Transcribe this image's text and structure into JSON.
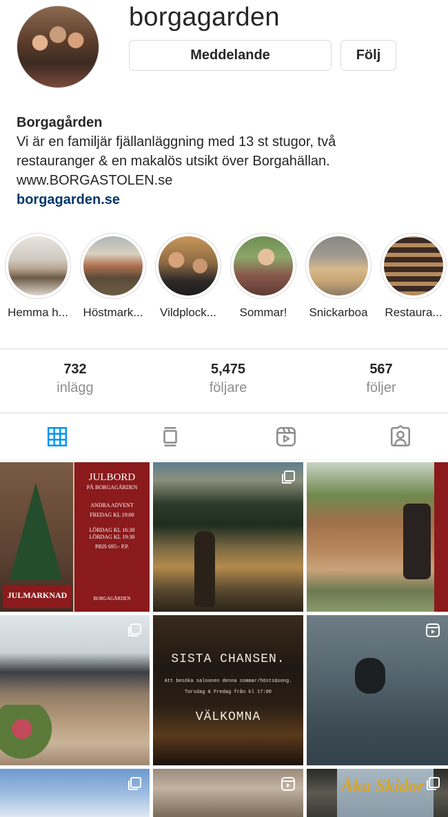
{
  "profile": {
    "username": "borgagarden",
    "message_label": "Meddelande",
    "follow_label": "Följ",
    "name": "Borgagården",
    "bio_line1": "Vi är en familjär fjällanläggning med 13 st stugor, två",
    "bio_line2": "restauranger & en makalös utsikt över Borgahällan.",
    "bio_line3": "www.BORGASTOLEN.se",
    "link": "borgagarden.se"
  },
  "highlights": [
    {
      "label": "Hemma h..."
    },
    {
      "label": "Höstmark..."
    },
    {
      "label": "Vildplock..."
    },
    {
      "label": "Sommar!"
    },
    {
      "label": "Snickarboa"
    },
    {
      "label": "Restaura..."
    }
  ],
  "stats": [
    {
      "value": "732",
      "label": "inlägg"
    },
    {
      "value": "5,475",
      "label": "följare"
    },
    {
      "value": "567",
      "label": "följer"
    }
  ],
  "tabs": [
    {
      "icon": "grid-icon",
      "active": true
    },
    {
      "icon": "guide-icon",
      "active": false
    },
    {
      "icon": "reels-icon",
      "active": false
    },
    {
      "icon": "tagged-icon",
      "active": false
    }
  ],
  "posts": {
    "post1": {
      "heading": "JULBORD",
      "subheading": "PÅ BORGAGÅRDEN",
      "line1": "ANDRA ADVENT",
      "line2": "FREDAG KL 19:00",
      "line3": "LÖRDAG KL 16:30",
      "line4": "LÖRDAG KL 19:30",
      "price": "PRIS 695:- P.P.",
      "left_banner": "JULMARKNAD",
      "brand": "BORGAGÅRDEN"
    },
    "post5": {
      "line1": "SISTA CHANSEN.",
      "line2": "Att besöka saloonen denna sommar/höstsäsong.",
      "line3": "Torsdag & Fredag från kl 17:00",
      "line4": "VÄLKOMNA"
    },
    "post9": {
      "text": "Åka Skidor"
    }
  },
  "colors": {
    "accent_blue": "#0095f6",
    "link_blue": "#00376b",
    "julbord_red": "#8a1a1c",
    "text_gray": "#8e8e8e"
  }
}
